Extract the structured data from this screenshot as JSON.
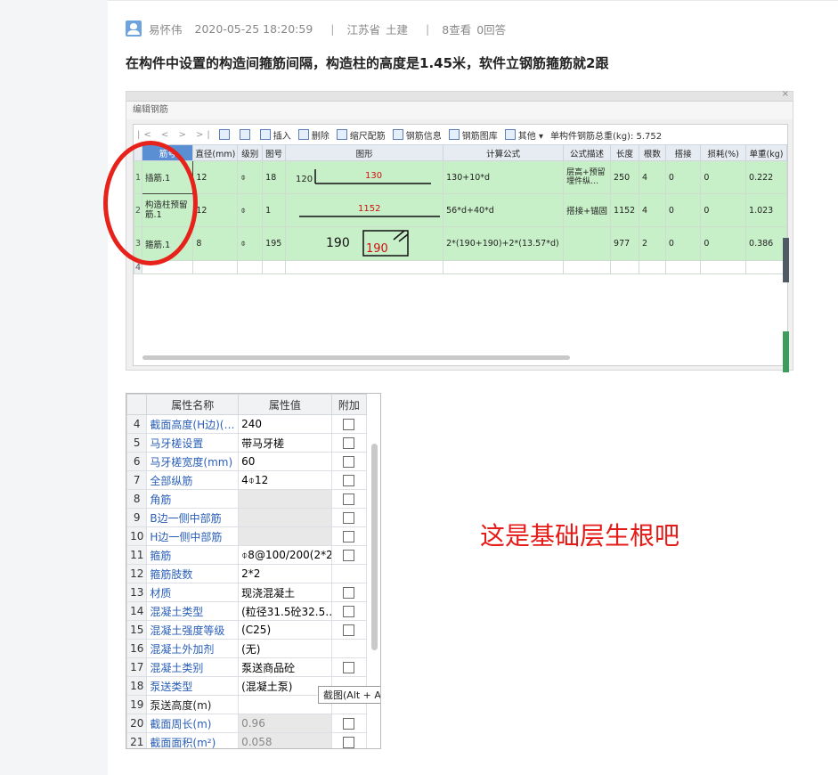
{
  "post": {
    "author": "易怀伟",
    "datetime": "2020-05-25 18:20:59",
    "region_province": "江苏省",
    "region_category": "土建",
    "stats_views": "8查看",
    "stats_answers": "0回答",
    "separator": "|",
    "title": "在构件中设置的构造间箍筋间隔，构造柱的高度是1.45米，软件立钢筋箍筋就2跟",
    "comment": "这是基础层生根吧"
  },
  "rebar_editor": {
    "window_title": "编辑钢筋",
    "close": "×",
    "nav": "|< < > >|",
    "toolbar": [
      "插入",
      "删除",
      "缩尺配筋",
      "钢筋信息",
      "钢筋图库",
      "其他 ▾"
    ],
    "total_weight": "单构件钢筋总重(kg): 5.752",
    "columns": [
      "筋号",
      "直径(mm)",
      "级别",
      "图号",
      "图形",
      "计算公式",
      "公式描述",
      "长度",
      "根数",
      "搭接",
      "损耗(%)",
      "单重(kg)"
    ],
    "rows": [
      {
        "n": "1",
        "name": "插筋.1",
        "dia": "12",
        "grade": "⌽",
        "fig": "18",
        "shape_left": "120",
        "shape_top": "130",
        "formula": "130+10*d",
        "desc": "层高+预留埋件纵…",
        "len": "250",
        "count": "4",
        "lap": "0",
        "loss": "0",
        "weight": "0.222"
      },
      {
        "n": "2",
        "name": "构造柱预留筋.1",
        "dia": "12",
        "grade": "⌽",
        "fig": "1",
        "shape_top": "1152",
        "formula": "56*d+40*d",
        "desc": "搭接+锚固",
        "len": "1152",
        "count": "4",
        "lap": "0",
        "loss": "0",
        "weight": "1.023"
      },
      {
        "n": "3",
        "name": "箍筋.1",
        "dia": "8",
        "grade": "⌽",
        "fig": "195",
        "shape_left": "190",
        "shape_box": "190",
        "formula": "2*(190+190)+2*(13.57*d)",
        "desc": "",
        "len": "977",
        "count": "2",
        "lap": "0",
        "loss": "0",
        "weight": "0.386"
      },
      {
        "n": "4"
      }
    ]
  },
  "properties": {
    "columns": [
      "属性名称",
      "属性值",
      "附加"
    ],
    "rows": [
      {
        "n": "4",
        "name": "截面高度(H边)(…",
        "value": "240",
        "check": true
      },
      {
        "n": "5",
        "name": "马牙槎设置",
        "value": "带马牙槎",
        "check": true
      },
      {
        "n": "6",
        "name": "马牙槎宽度(mm)",
        "value": "60",
        "check": true
      },
      {
        "n": "7",
        "name": "全部纵筋",
        "value": "4⌽12",
        "check": true
      },
      {
        "n": "8",
        "name": "角筋",
        "value": "",
        "check": true,
        "gray": true
      },
      {
        "n": "9",
        "name": "B边一侧中部筋",
        "value": "",
        "check": true,
        "gray": true
      },
      {
        "n": "10",
        "name": "H边一侧中部筋",
        "value": "",
        "check": true,
        "gray": true
      },
      {
        "n": "11",
        "name": "箍筋",
        "value": "⌽8@100/200(2*2",
        "check": true
      },
      {
        "n": "12",
        "name": "箍筋肢数",
        "value": "2*2",
        "check": false
      },
      {
        "n": "13",
        "name": "材质",
        "value": "现浇混凝土",
        "check": true
      },
      {
        "n": "14",
        "name": "混凝土类型",
        "value": "(粒径31.5砼32.5…",
        "check": true
      },
      {
        "n": "15",
        "name": "混凝土强度等级",
        "value": "(C25)",
        "check": true
      },
      {
        "n": "16",
        "name": "混凝土外加剂",
        "value": "(无)",
        "check": false
      },
      {
        "n": "17",
        "name": "混凝土类别",
        "value": "泵送商品砼",
        "check": true
      },
      {
        "n": "18",
        "name": "泵送类型",
        "value": "(混凝土泵)",
        "check": false
      },
      {
        "n": "19",
        "name": "泵送高度(m)",
        "value": "",
        "check": false,
        "black": true
      },
      {
        "n": "20",
        "name": "截面周长(m)",
        "value": "0.96",
        "check": true,
        "gray": true
      },
      {
        "n": "21",
        "name": "截面面积(m²)",
        "value": "0.058",
        "check": true,
        "gray": true
      }
    ],
    "tooltip": "截图(Alt + A"
  },
  "colors": {
    "accent_red": "#e41b17",
    "green_row": "#c8f0c8",
    "link_blue": "#2a5fb8"
  }
}
